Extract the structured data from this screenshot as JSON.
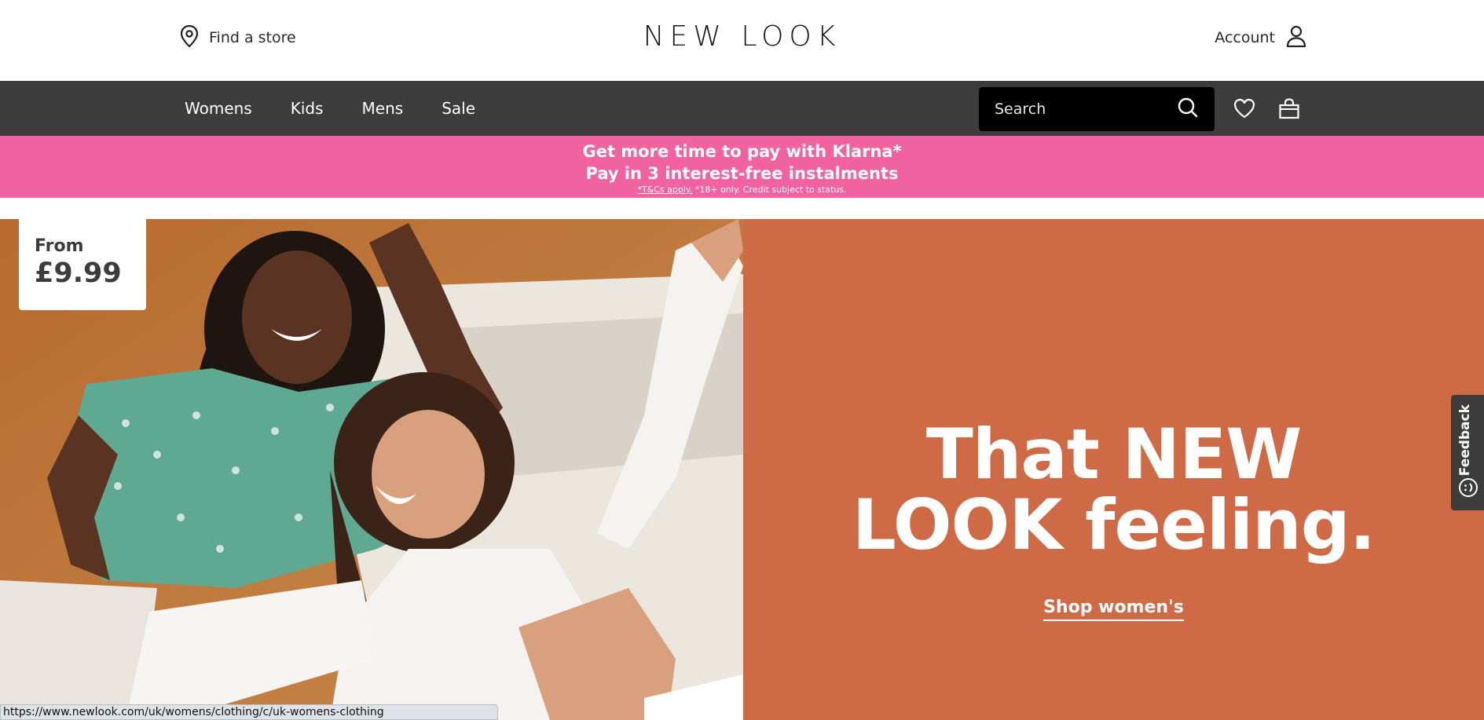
{
  "header": {
    "find_store_label": "Find a store",
    "logo_text": "NEW LOOK",
    "account_label": "Account"
  },
  "nav": {
    "items": [
      {
        "label": "Womens"
      },
      {
        "label": "Kids"
      },
      {
        "label": "Mens"
      },
      {
        "label": "Sale"
      }
    ],
    "search_placeholder": "Search"
  },
  "promo": {
    "line1": "Get more time to pay with Klarna*",
    "line2": "Pay in 3 interest-free instalments",
    "tc_link": "*T&Cs apply.",
    "tc_text": " *18+ only. Credit subject to status."
  },
  "hero": {
    "badge_from": "From",
    "badge_price": "£9.99",
    "headline_line1": "That NEW",
    "headline_line2": "LOOK feeling.",
    "cta": "Shop women's",
    "panel_color": "#cf6a46"
  },
  "feedback": {
    "label": "Feedback"
  },
  "status_bar": {
    "url": "https://www.newlook.com/uk/womens/clothing/c/uk-womens-clothing"
  },
  "colors": {
    "nav_bg": "#3c3c3c",
    "promo_bg": "#f062a0",
    "search_bg": "#000000"
  },
  "icons": [
    "location-pin-icon",
    "user-icon",
    "search-icon",
    "heart-icon",
    "bag-icon",
    "smiley-icon"
  ]
}
